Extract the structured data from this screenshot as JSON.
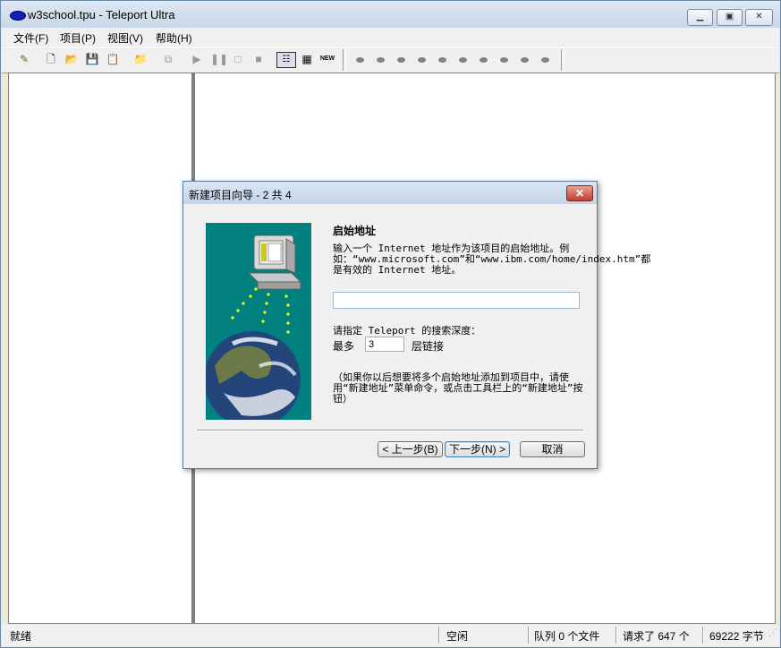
{
  "window": {
    "title": "w3school.tpu - Teleport Ultra"
  },
  "menu": [
    {
      "label": "文件(F)"
    },
    {
      "label": "项目(P)"
    },
    {
      "label": "视图(V)"
    },
    {
      "label": "帮助(H)"
    }
  ],
  "toolbar": {
    "new_label": "NEW"
  },
  "dialog": {
    "title": "新建项目向导 - 2 共 4",
    "heading": "启始地址",
    "description": "输入一个 Internet 地址作为该项目的启始地址。例如：“www.microsoft.com”和“www.ibm.com/home/index.htm”都是有效的 Internet 地址。",
    "url_value": "",
    "depth_prompt": "请指定 Teleport 的搜索深度：",
    "max_label": "最多",
    "depth_value": "3",
    "layer_label": "层链接",
    "note": "（如果你以后想要将多个启始地址添加到项目中，请使用“新建地址”菜单命令，或点击工具栏上的“新建地址”按钮）",
    "back_label": "< 上一步(B)",
    "next_label": "下一步(N) >",
    "cancel_label": "取消"
  },
  "status": {
    "ready": "就绪",
    "idle": "空闲",
    "queue": "队列 0 个文件",
    "requested": "请求了 647 个",
    "bytes": "69222 字节"
  },
  "colors": {
    "illustration_bg": "#00807f",
    "title_gradient_top": "#dfe8f3"
  }
}
